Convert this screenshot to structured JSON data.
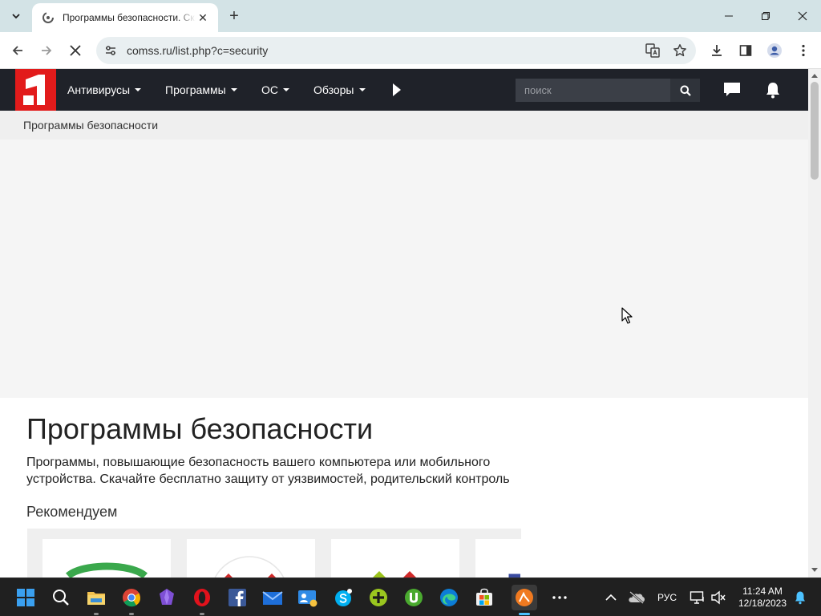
{
  "browser": {
    "tab_title": "Программы безопасности. Скачать бесплатно",
    "url": "comss.ru/list.php?c=security"
  },
  "site": {
    "logo_text": "1",
    "nav": [
      {
        "label": "Антивирусы"
      },
      {
        "label": "Программы"
      },
      {
        "label": "ОС"
      },
      {
        "label": "Обзоры"
      }
    ],
    "search_placeholder": "поиск"
  },
  "breadcrumb": "Программы безопасности",
  "content": {
    "title": "Программы безопасности",
    "description": "Программы, повышающие безопасность вашего компьютера или мобильного устройства. Скачайте бесплатно защиту от уязвимостей, родительский контроль",
    "section_title": "Рекомендуем"
  },
  "taskbar": {
    "language": "РУС",
    "time": "11:24 AM",
    "date": "12/18/2023"
  },
  "colors": {
    "header_bg": "#1f2229",
    "logo_red": "#e21b1b",
    "tabstrip_bg": "#d3e3e6"
  }
}
